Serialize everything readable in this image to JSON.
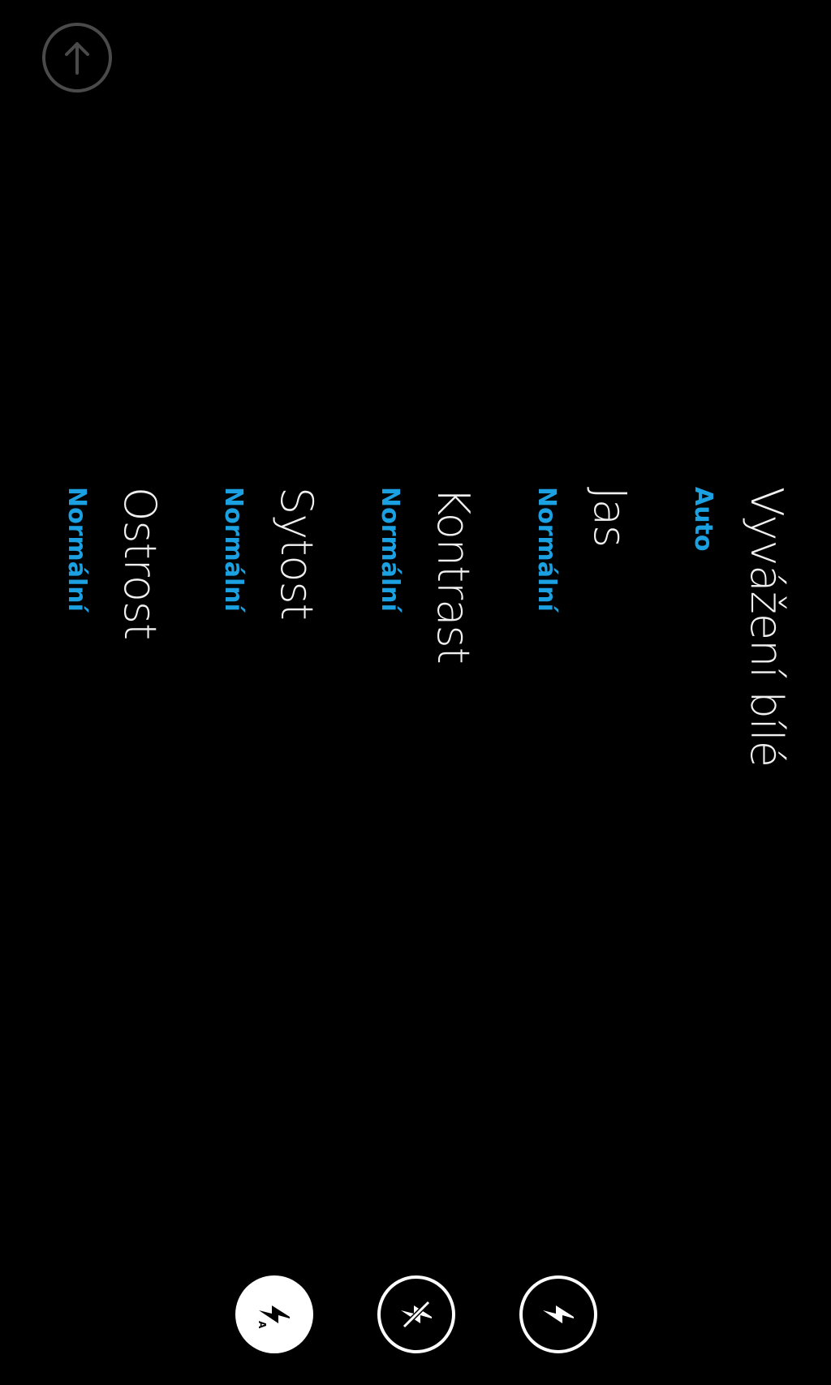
{
  "settings": {
    "items": [
      {
        "label": "Vyvážení bílé",
        "value": "Auto"
      },
      {
        "label": "Jas",
        "value": "Normální"
      },
      {
        "label": "Kontrast",
        "value": "Normální"
      },
      {
        "label": "Sytost",
        "value": "Normální"
      },
      {
        "label": "Ostrost",
        "value": "Normální"
      }
    ]
  },
  "controls": {
    "back_icon": "up-arrow-icon",
    "flash_modes": [
      {
        "icon": "flash-auto-icon",
        "selected": true
      },
      {
        "icon": "flash-off-icon",
        "selected": false
      },
      {
        "icon": "flash-on-icon",
        "selected": false
      }
    ]
  },
  "colors": {
    "background": "#000000",
    "label": "#f0f0f0",
    "accent": "#1ba1e2",
    "button_border": "#ffffff",
    "back_border": "#4a4a4a"
  }
}
